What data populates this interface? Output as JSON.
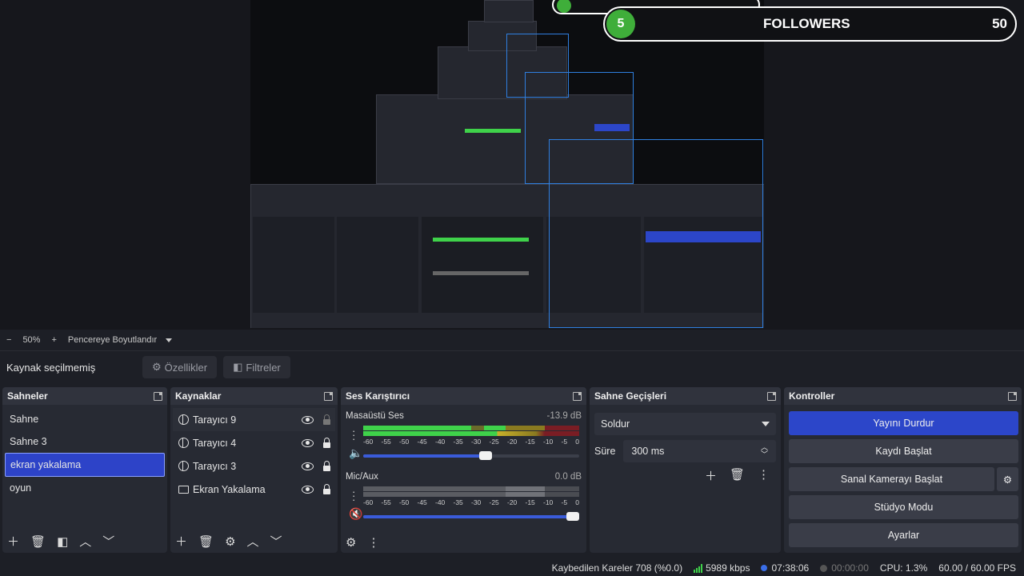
{
  "preview": {
    "followers_label": "FOLLOWERS",
    "followers_count_left": "5",
    "followers_count_right": "50"
  },
  "zoom": {
    "minus": "−",
    "level": "50%",
    "plus": "+",
    "mode": "Pencereye Boyutlandır"
  },
  "source_bar": {
    "status": "Kaynak seçilmemiş",
    "properties": "Özellikler",
    "filters": "Filtreler"
  },
  "scenes": {
    "title": "Sahneler",
    "items": [
      "Sahne",
      "Sahne 3",
      "ekran yakalama",
      "oyun"
    ],
    "active_index": 2
  },
  "sources": {
    "title": "Kaynaklar",
    "items": [
      {
        "name": "Tarayıcı 9",
        "icon": "globe-icon",
        "locked": false
      },
      {
        "name": "Tarayıcı 4",
        "icon": "globe-icon",
        "locked": true
      },
      {
        "name": "Tarayıcı 3",
        "icon": "globe-icon",
        "locked": true
      },
      {
        "name": "Ekran Yakalama",
        "icon": "monitor-icon",
        "locked": true
      }
    ]
  },
  "mixer": {
    "title": "Ses Karıştırıcı",
    "channels": [
      {
        "name": "Masaüstü Ses",
        "db": "-13.9 dB",
        "level": 0.6,
        "volume": 0.63
      },
      {
        "name": "Mic/Aux",
        "db": "0.0 dB",
        "level": 0.0,
        "volume": 1.0
      }
    ],
    "ticks": [
      "-60",
      "-55",
      "-50",
      "-45",
      "-40",
      "-35",
      "-30",
      "-25",
      "-20",
      "-15",
      "-10",
      "-5",
      "0"
    ]
  },
  "transitions": {
    "title": "Sahne Geçişleri",
    "selected": "Soldur",
    "duration_label": "Süre",
    "duration_value": "300 ms"
  },
  "controls": {
    "title": "Kontroller",
    "stop_stream": "Yayını Durdur",
    "start_record": "Kaydı Başlat",
    "start_virtualcam": "Sanal Kamerayı Başlat",
    "studio_mode": "Stüdyo Modu",
    "settings": "Ayarlar"
  },
  "status": {
    "dropped_frames": "Kaybedilen Kareler 708 (%0.0)",
    "bitrate": "5989 kbps",
    "stream_time": "07:38:06",
    "record_time": "00:00:00",
    "cpu": "CPU: 1.3%",
    "fps": "60.00 / 60.00 FPS"
  },
  "colors": {
    "accent": "#2c46c9",
    "meter_green": "#3fd24a",
    "meter_yellow": "#c9b12a",
    "meter_red": "#b3242e",
    "panel": "#272a33"
  }
}
